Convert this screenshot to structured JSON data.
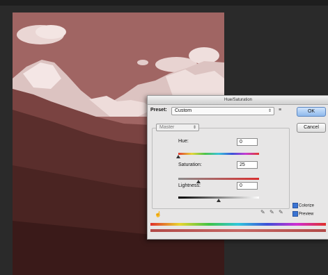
{
  "colors": {
    "workspace": "#2a2a2a",
    "tint": "#9a5e5c",
    "dialog_bg": "#e7e6e6",
    "ok_button": "#8fb9ec"
  },
  "dialog": {
    "title": "Hue/Saturation",
    "preset_label": "Preset:",
    "preset_value": "Custom",
    "preset_menu_icon": "menu-icon",
    "ok_label": "OK",
    "cancel_label": "Cancel",
    "channel_value": "Master",
    "hue": {
      "label": "Hue:",
      "value": "0",
      "position": 0.0
    },
    "saturation": {
      "label": "Saturation:",
      "value": "25",
      "position": 0.25
    },
    "lightness": {
      "label": "Lightness:",
      "value": "0",
      "position": 0.5
    },
    "colorize": {
      "label": "Colorize",
      "checked": true
    },
    "preview": {
      "label": "Preview",
      "checked": true
    }
  }
}
